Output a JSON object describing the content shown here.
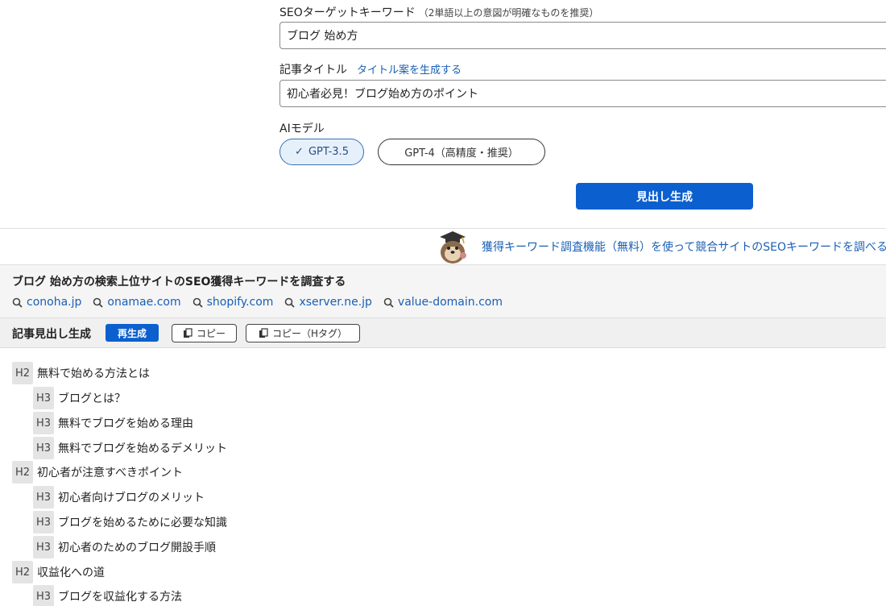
{
  "form": {
    "seo_keyword": {
      "label": "SEOターゲットキーワード",
      "note": "（2単語以上の意図が明確なものを推奨）",
      "value": "ブログ 始め方"
    },
    "article_title": {
      "label": "記事タイトル",
      "link": "タイトル案を生成する",
      "value": "初心者必見！ブログ始め方のポイント"
    },
    "ai_model": {
      "label": "AIモデル",
      "options": [
        "GPT-3.5",
        "GPT-4（高精度・推奨）"
      ],
      "selected": "GPT-3.5"
    },
    "generate_button": "見出し生成"
  },
  "promo": {
    "link_text": "獲得キーワード調査機能（無料）を使って競合サイトのSEOキーワードを調べる"
  },
  "research": {
    "title": "ブログ 始め方の検索上位サイトのSEO獲得キーワードを調査する",
    "sites": [
      "conoha.jp",
      "onamae.com",
      "shopify.com",
      "xserver.ne.jp",
      "value-domain.com"
    ]
  },
  "toolbar": {
    "title": "記事見出し生成",
    "regenerate": "再生成",
    "copy": "コピー",
    "copy_htag": "コピー（Hタグ）"
  },
  "outline": [
    {
      "level": "H2",
      "text": "無料で始める方法とは"
    },
    {
      "level": "H3",
      "text": "ブログとは？"
    },
    {
      "level": "H3",
      "text": "無料でブログを始める理由"
    },
    {
      "level": "H3",
      "text": "無料でブログを始めるデメリット"
    },
    {
      "level": "H2",
      "text": "初心者が注意すべきポイント"
    },
    {
      "level": "H3",
      "text": "初心者向けブログのメリット"
    },
    {
      "level": "H3",
      "text": "ブログを始めるために必要な知識"
    },
    {
      "level": "H3",
      "text": "初心者のためのブログ開設手順"
    },
    {
      "level": "H2",
      "text": "収益化への道"
    },
    {
      "level": "H3",
      "text": "ブログを収益化する方法"
    }
  ],
  "colors": {
    "primary": "#0c5fcf",
    "link": "#1a5fb4",
    "selected_bg": "#e6f0fb"
  }
}
